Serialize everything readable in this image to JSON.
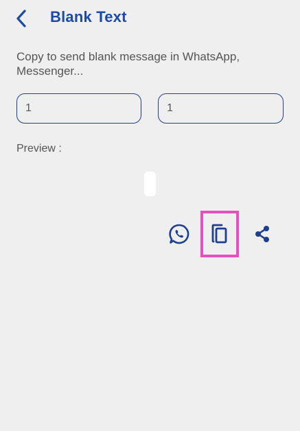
{
  "header": {
    "back_icon": "chevron-left-icon",
    "title": "Blank Text"
  },
  "description": "Copy to send blank message in WhatsApp, Messenger...",
  "inputs": {
    "left_value": "1",
    "right_value": "1"
  },
  "preview": {
    "label": "Preview :"
  },
  "actions": {
    "whatsapp_icon": "whatsapp-icon",
    "copy_icon": "copy-icon",
    "share_icon": "share-icon"
  },
  "colors": {
    "accent": "#1c4aa6",
    "highlight": "#e54fc0",
    "background": "#efefef"
  }
}
